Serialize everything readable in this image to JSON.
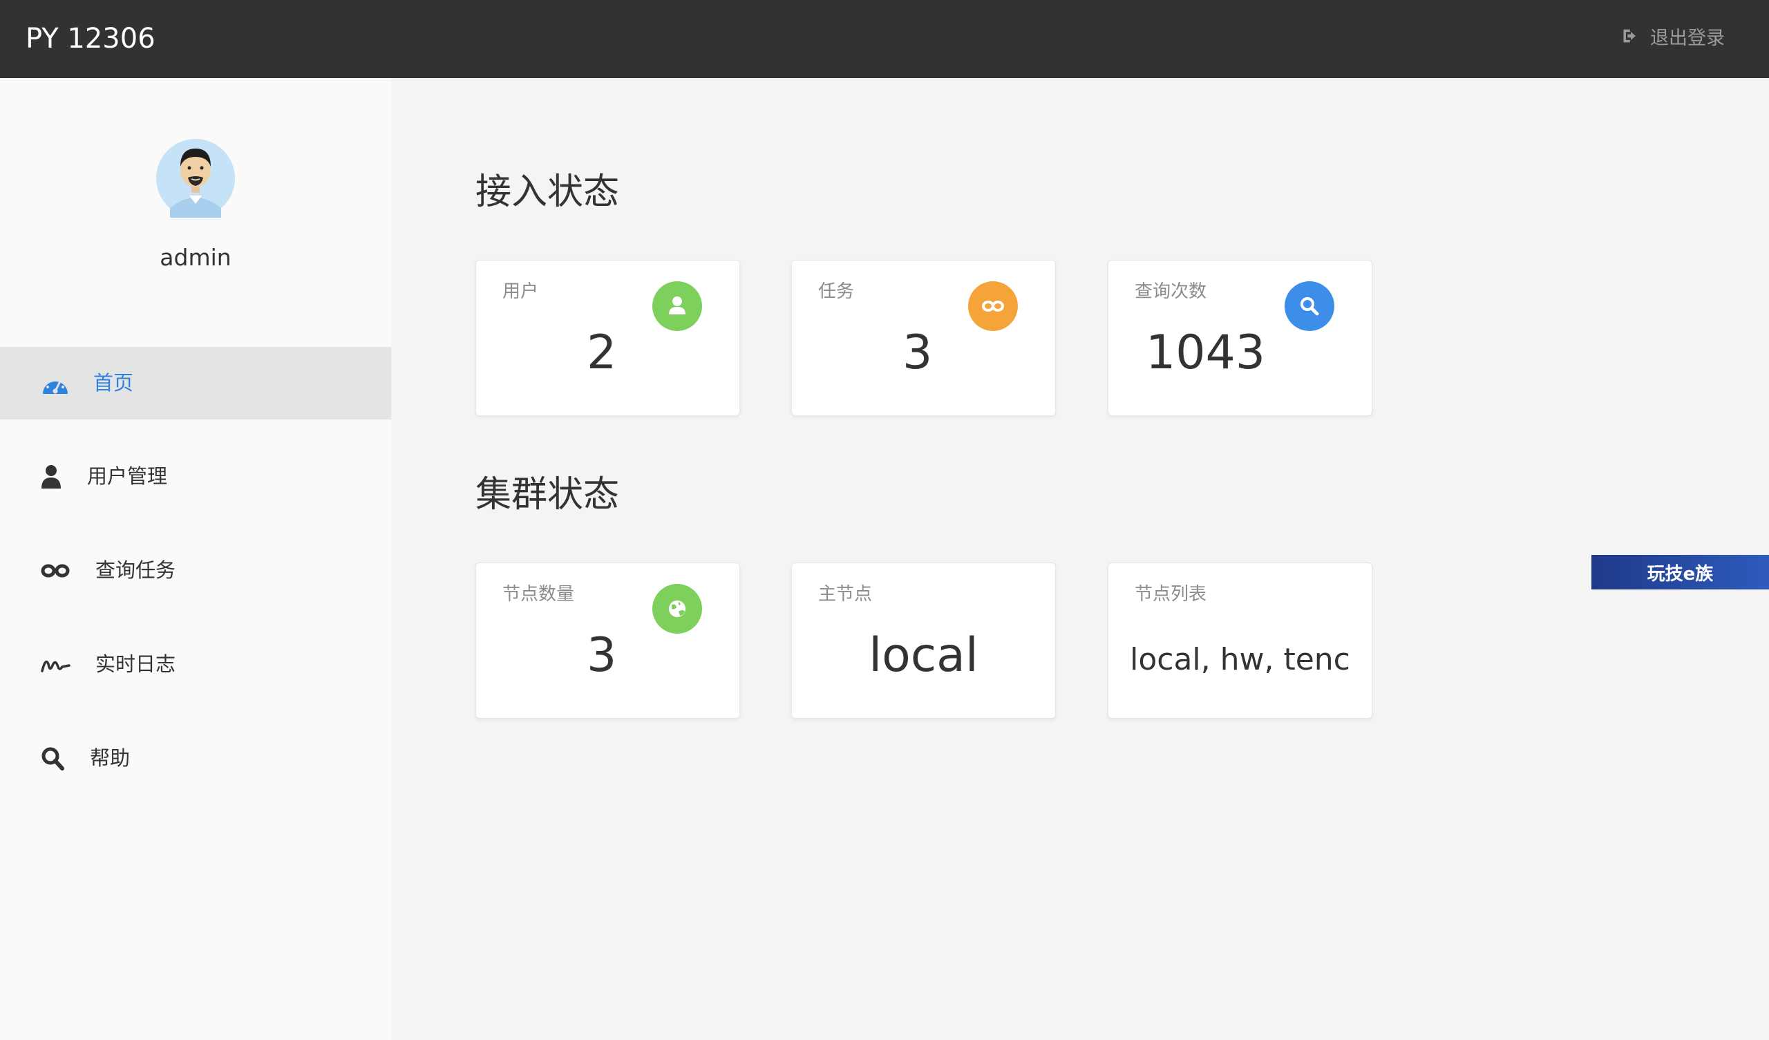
{
  "header": {
    "brand": "PY 12306",
    "logout_label": "退出登录"
  },
  "sidebar": {
    "username": "admin",
    "items": [
      {
        "label": "首页",
        "icon": "dashboard-icon",
        "active": true
      },
      {
        "label": "用户管理",
        "icon": "user-icon"
      },
      {
        "label": "查询任务",
        "icon": "infinity-icon"
      },
      {
        "label": "实时日志",
        "icon": "signature-icon"
      },
      {
        "label": "帮助",
        "icon": "search-icon"
      }
    ]
  },
  "access_status": {
    "title": "接入状态",
    "cards": [
      {
        "label": "用户",
        "value": "2",
        "icon": "user-icon",
        "color": "#7ed05c"
      },
      {
        "label": "任务",
        "value": "3",
        "icon": "infinity-icon",
        "color": "#f5a43a"
      },
      {
        "label": "查询次数",
        "value": "1043",
        "icon": "search-icon",
        "color": "#3d8ee8"
      }
    ]
  },
  "cluster_status": {
    "title": "集群状态",
    "cards": [
      {
        "label": "节点数量",
        "value": "3",
        "icon": "globe-icon",
        "color": "#7ed05c"
      },
      {
        "label": "主节点",
        "value": "local"
      },
      {
        "label": "节点列表",
        "value": "local, hw, tenc"
      }
    ]
  },
  "watermark": "玩技e族",
  "colors": {
    "topbar": "#323232",
    "accent": "#2f83e0",
    "green": "#7ed05c",
    "orange": "#f5a43a",
    "blue": "#3d8ee8"
  }
}
